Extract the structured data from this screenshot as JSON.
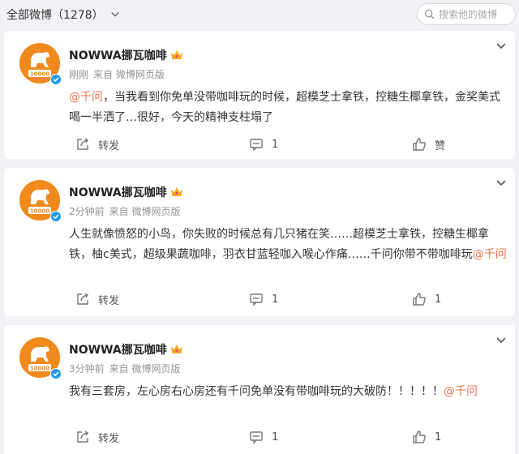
{
  "filter": {
    "label": "全部微博（1278）"
  },
  "search": {
    "placeholder": "搜索他的微博"
  },
  "colors": {
    "mention": "#eb7350",
    "crown": "#f5a623",
    "verified": "#1d9bf0",
    "avatar_bg": "#f08a1c"
  },
  "posts": [
    {
      "author": "NOWWA挪瓦咖啡",
      "time": "刚刚",
      "source": "来自 微博网页版",
      "mention_lead": "@千问",
      "text": "，当我看到你免单没带咖啡玩的时候，超模芝士拿铁，控糖生椰拿铁，金奖美式喝一半洒了…很好，今天的精神支柱塌了",
      "share_label": "转发",
      "comment_count": "1",
      "like_label": "赞"
    },
    {
      "author": "NOWWA挪瓦咖啡",
      "time": "2分钟前",
      "source": "来自 微博网页版",
      "text": "人生就像愤怒的小鸟，你失败的时候总有几只猪在笑……超模芝士拿铁，控糖生椰拿铁，柚c美式，超级果蔬咖啡，羽衣甘蓝轻咖入喉心作痛……千问你带不带咖啡玩",
      "mention_tail": "@千问",
      "share_label": "转发",
      "comment_count": "1",
      "like_count": "1"
    },
    {
      "author": "NOWWA挪瓦咖啡",
      "time": "3分钟前",
      "source": "来自 微博网页版",
      "text": "我有三套房，左心房右心房还有千问免单没有带咖啡玩的大破防！！！！！",
      "mention_tail": "@千问",
      "share_label": "转发",
      "comment_count": "1",
      "like_count": "1"
    }
  ]
}
